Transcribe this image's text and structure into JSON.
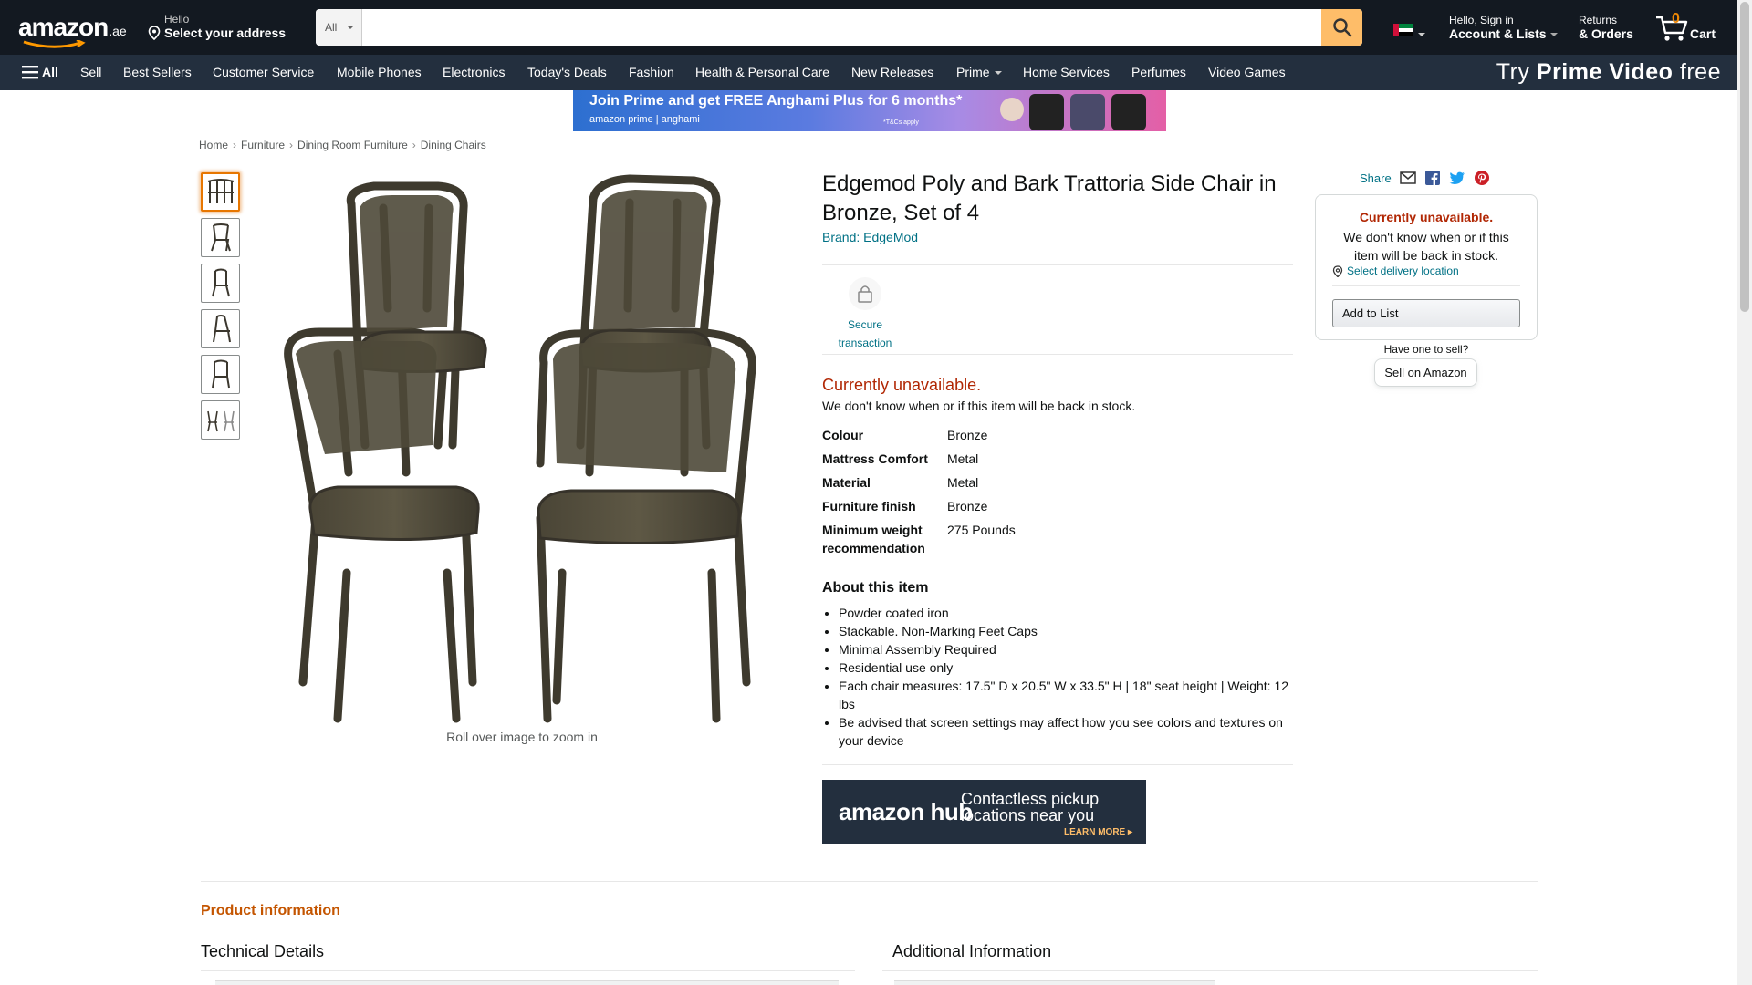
{
  "header": {
    "logo_text": "amazon",
    "logo_tld": ".ae",
    "deliver_line1": "Hello",
    "deliver_line2": "Select your address",
    "search_category": "All",
    "search_placeholder": "",
    "account_line1": "Hello, Sign in",
    "account_line2": "Account & Lists",
    "returns_line1": "Returns",
    "returns_line2": "& Orders",
    "cart_count": "0",
    "cart_label": "Cart"
  },
  "nav": {
    "all": "All",
    "items": [
      "Sell",
      "Best Sellers",
      "Customer Service",
      "Mobile Phones",
      "Electronics",
      "Today's Deals",
      "Fashion",
      "Health & Personal Care",
      "New Releases",
      "Prime",
      "Home Services",
      "Perfumes",
      "Video Games"
    ],
    "promo_prefix": "Try",
    "promo_bold": "Prime Video",
    "promo_suffix": "free"
  },
  "banner": {
    "line1": "Join Prime and get FREE Anghami Plus for 6 months*",
    "line2": "amazon prime  |  anghami",
    "tc": "*T&Cs apply"
  },
  "breadcrumb": [
    "Home",
    "Furniture",
    "Dining Room Furniture",
    "Dining Chairs"
  ],
  "gallery": {
    "rollover": "Roll over image to zoom in",
    "thumb_count": 6
  },
  "product": {
    "title": "Edgemod Poly and Bark Trattoria Side Chair in Bronze, Set of 4",
    "brand": "Brand: EdgeMod",
    "secure_label": "Secure transaction",
    "unavailable": "Currently unavailable.",
    "unavailable_sub": "We don't know when or if this item will be back in stock.",
    "specs": [
      {
        "key": "Colour",
        "value": "Bronze"
      },
      {
        "key": "Mattress Comfort",
        "value": "Metal"
      },
      {
        "key": "Material",
        "value": "Metal"
      },
      {
        "key": "Furniture finish",
        "value": "Bronze"
      },
      {
        "key": "Minimum weight recommendation",
        "value": "275 Pounds"
      }
    ],
    "about_heading": "About this item",
    "bullets": [
      "Powder coated iron",
      "Stackable. Non-Marking Feet Caps",
      "Minimal Assembly Required",
      "Residential use only",
      "Each chair measures: 17.5\" D x 20.5\" W x 33.5\" H | 18\" seat height | Weight: 12 lbs",
      "Be advised that screen settings may affect how you see colors and textures on your device"
    ]
  },
  "hub": {
    "brand": "amazon hub",
    "tagline": "Contactless pickup locations near you",
    "cta": "LEARN MORE ▸"
  },
  "buybox": {
    "share": "Share",
    "unavailable": "Currently unavailable.",
    "message": "We don't know when or if this item will be back in stock.",
    "location_link": "Select delivery location",
    "add_to_list": "Add to List",
    "have_one": "Have one to sell?",
    "sell_button": "Sell on Amazon"
  },
  "bottom": {
    "product_info": "Product information",
    "technical_details": "Technical Details",
    "additional_info": "Additional Information"
  },
  "colors": {
    "header_bg": "#131921",
    "nav_bg": "#232F3E",
    "search_button": "#FEBD69",
    "link": "#007185",
    "unavailable": "#B12704",
    "orange": "#C45500"
  }
}
